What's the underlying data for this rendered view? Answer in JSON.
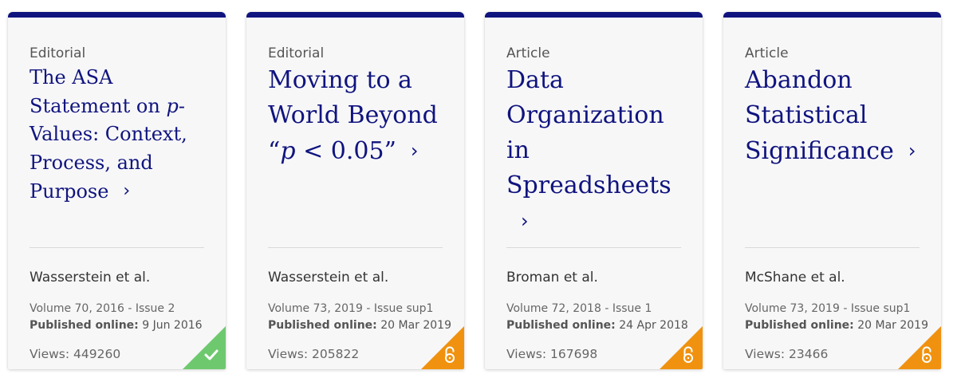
{
  "cards": [
    {
      "type": "Editorial",
      "title_parts": {
        "pre": "The ASA Statement on ",
        "italic": "p",
        "post": "-Values: Context, Process, and Purpose"
      },
      "chevron": "›",
      "authors": "Wasserstein et al.",
      "volume": "Volume 70, 2016 - Issue 2",
      "published_label": "Published online:",
      "published_date": "9 Jun 2016",
      "views": "Views: 449260",
      "badge": {
        "kind": "free-access",
        "icon": "checkmark-icon",
        "color": "#6ec96e"
      }
    },
    {
      "type": "Editorial",
      "title_parts": {
        "line1": "Moving to a",
        "line2": "World Beyond",
        "open_quote": "“",
        "italic": "p",
        "post": " < 0.05”"
      },
      "chevron": "›",
      "authors": "Wasserstein et al.",
      "volume": "Volume 73, 2019 - Issue sup1",
      "published_label": "Published online:",
      "published_date": "20 Mar 2019",
      "views": "Views: 205822",
      "badge": {
        "kind": "open-access",
        "icon": "open-lock-icon",
        "color": "#f0920f"
      }
    },
    {
      "type": "Article",
      "title_lines": [
        "Data",
        "Organization",
        "in",
        "Spreadsheets"
      ],
      "chevron": "›",
      "authors": "Broman et al.",
      "volume": "Volume 72, 2018 - Issue 1",
      "published_label": "Published online:",
      "published_date": "24 Apr 2018",
      "views": "Views: 167698",
      "badge": {
        "kind": "open-access",
        "icon": "open-lock-icon",
        "color": "#f0920f"
      }
    },
    {
      "type": "Article",
      "title_lines": [
        "Abandon",
        "Statistical",
        "Significance"
      ],
      "chevron": "›",
      "authors": "McShane et al.",
      "volume": "Volume 73, 2019 - Issue sup1",
      "published_label": "Published online:",
      "published_date": "20 Mar 2019",
      "views": "Views: 23466",
      "badge": {
        "kind": "open-access",
        "icon": "open-lock-icon",
        "color": "#f0920f"
      }
    }
  ],
  "colors": {
    "accent": "#10147e",
    "card_bg": "#f7f7f8",
    "free_badge": "#6ec96e",
    "open_badge": "#f0920f"
  }
}
